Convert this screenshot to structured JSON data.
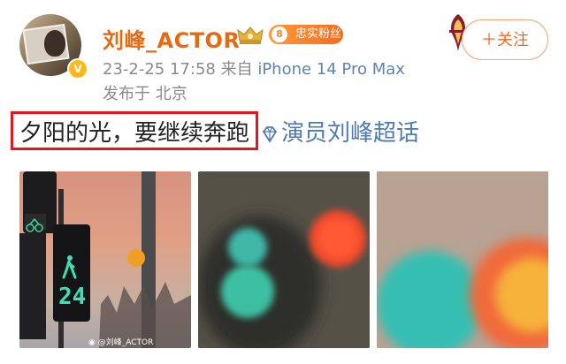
{
  "user": {
    "name": "刘峰_ACTOR",
    "fan_badge_level": "8",
    "fan_badge_text": "忠实粉丝",
    "verified_mark": "V"
  },
  "follow_button": {
    "label": "＋关注"
  },
  "meta": {
    "time": "23-2-25 17:58",
    "source_prefix": "来自",
    "device": "iPhone 14 Pro Max",
    "location": "发布于 北京"
  },
  "post": {
    "text": "夕阳的光，要继续奔跑",
    "topic": "演员刘峰超话"
  },
  "images": {
    "traffic_light_number": "24",
    "watermark": "@刘峰_ACTOR"
  },
  "colors": {
    "username": "#e86a10",
    "highlight_box": "#e5161f",
    "topic_link": "#4f7bb5",
    "follow_border": "#f7a277"
  },
  "icons": [
    "verified-icon",
    "crown-icon",
    "diamond-icon",
    "team-logo-icon",
    "weibo-icon"
  ]
}
